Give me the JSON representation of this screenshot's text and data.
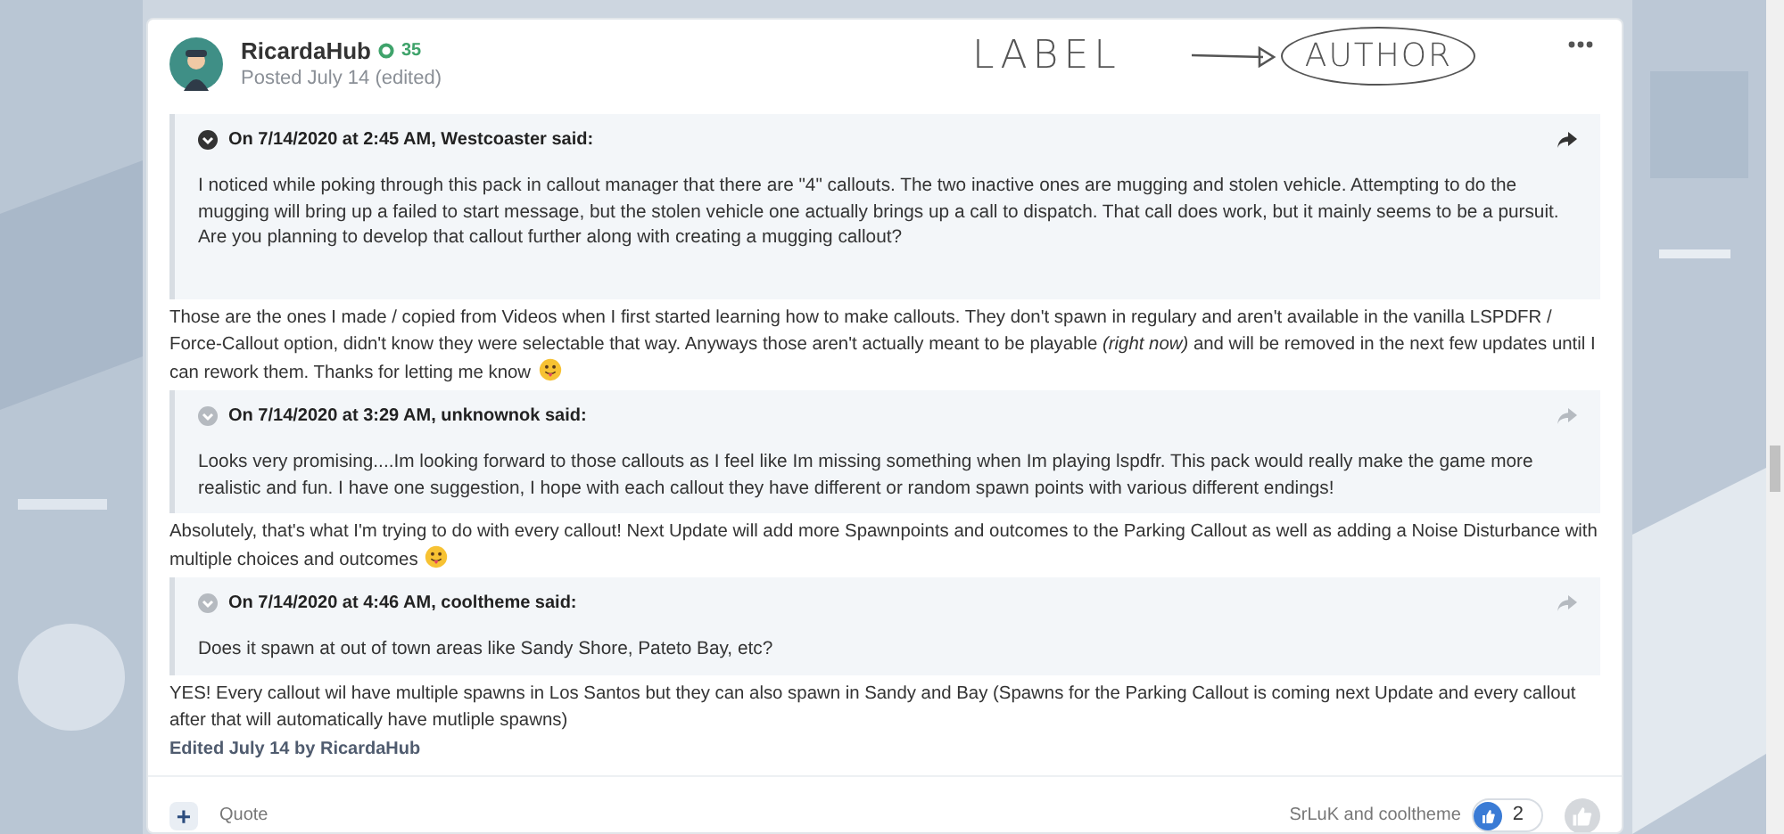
{
  "post": {
    "author": "RicardaHub",
    "reputation": "35",
    "posted": "Posted July 14 (edited)",
    "annotation": {
      "label": "LABEL",
      "target": "AUTHOR"
    },
    "blocks": [
      {
        "kind": "quote",
        "header": "On 7/14/2020 at 2:45 AM, Westcoaster said:",
        "expanded": true,
        "text": "I noticed while poking through this pack in callout manager that there are \"4\" callouts. The two inactive ones are mugging and stolen vehicle. Attempting to do the mugging will bring up a failed to start message, but the stolen vehicle one actually brings up a call to dispatch. That call does work, but it mainly seems to be a pursuit. Are you planning to develop that callout further along with creating a mugging callout?"
      },
      {
        "kind": "reply",
        "text": "Those are the ones I made / copied from Videos when I first started learning how to make callouts. They don't spawn in regulary and aren't available in the vanilla LSPDFR / Force-Callout option, didn't know they were selectable that way. Anyways those aren't actually meant to be playable *(right now)* and will be removed in the next few updates until I can rework them. Thanks for letting me know",
        "emoji": true
      },
      {
        "kind": "quote",
        "header": "On 7/14/2020 at 3:29 AM, unknownok said:",
        "expanded": false,
        "text": "Looks very promising....Im looking forward to those callouts as I feel like Im missing something when Im playing lspdfr. This pack would really make the game more realistic and fun. I have one suggestion, I hope with each callout they have different or random spawn points with various different endings!"
      },
      {
        "kind": "reply",
        "text": "Absolutely, that's what I'm trying to do with every callout! Next Update will add more Spawnpoints and outcomes to the Parking Callout as well as adding a Noise Disturbance with multiple choices and outcomes",
        "emoji": true
      },
      {
        "kind": "quote",
        "header": "On 7/14/2020 at 4:46 AM, cooltheme said:",
        "expanded": false,
        "text": "Does it spawn at out of town areas like Sandy Shore, Pateto Bay, etc?"
      },
      {
        "kind": "reply",
        "text": "YES! Every callout  wil have multiple spawns in Los Santos but they can also spawn in Sandy and Bay (Spawns for the Parking Callout is coming next Update and every callout after that will automatically have mutliple spawns)",
        "emoji": false
      }
    ],
    "edited": "Edited July 14 by RicardaHub",
    "footer": {
      "add": "+",
      "quote": "Quote",
      "reactors": "SrLuK and cooltheme",
      "reaction_count": "2"
    }
  }
}
